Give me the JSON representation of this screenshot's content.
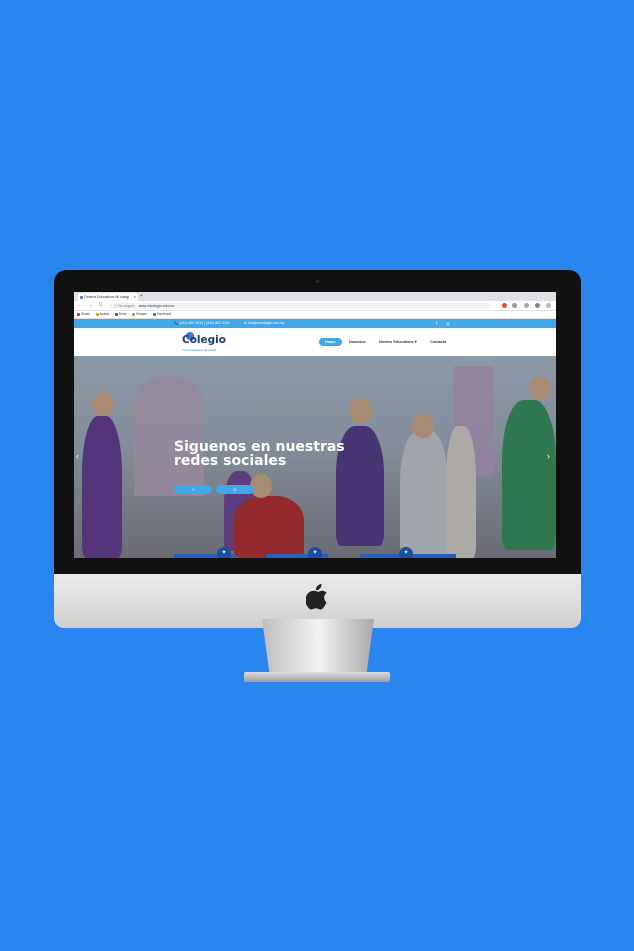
{
  "browser": {
    "tab_title": "Centros Educativos Mi colegi",
    "tab_close": "×",
    "new_tab": "+",
    "back": "←",
    "forward": "→",
    "reload": "C",
    "secure_label": "ⓘ No seguro",
    "url": "www.micolegio.edu.mx",
    "bookmarks": [
      {
        "label": "Gmail",
        "color": "#d93025"
      },
      {
        "label": "Avana",
        "color": "#f29900"
      },
      {
        "label": "Drive",
        "color": "#188038"
      },
      {
        "label": "Envato",
        "color": "#82b540"
      },
      {
        "label": "Facebook",
        "color": "#1877f2"
      }
    ]
  },
  "site": {
    "topbar": {
      "phone": "📞 (444) 822 3013 | (444) 822 3180",
      "email": "✉ info@micolegio.edu.mx",
      "facebook": "f",
      "instagram": "◎"
    },
    "logo": {
      "text": "Colegio",
      "subtitle": "Centros Educativos Mi Colegio"
    },
    "menu": {
      "home": "Home",
      "nosotros": "Nosotros",
      "niveles": "Niveles Educativos  ▾",
      "contacto": "Contacto"
    },
    "hero": {
      "title": "Siguenos en nuestras redes sociales",
      "btn_facebook": "f",
      "btn_instagram": "◎",
      "prev": "‹",
      "next": "›"
    },
    "colors": {
      "accent": "#41a7e6",
      "brand_dark": "#1f3b77",
      "background": "#2a86ee"
    }
  }
}
